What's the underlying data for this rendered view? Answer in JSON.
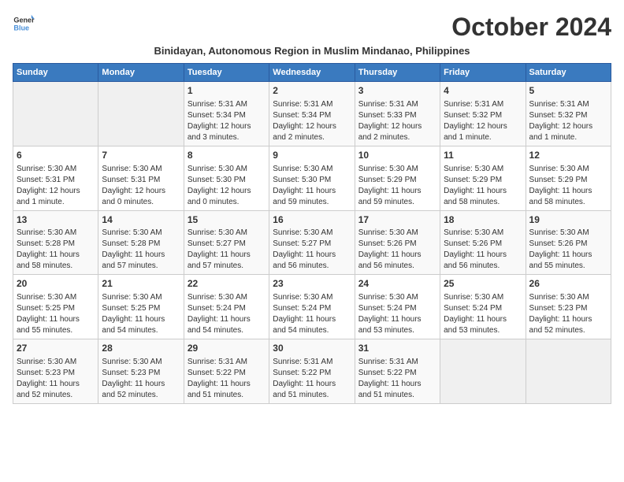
{
  "logo": {
    "line1": "General",
    "line2": "Blue"
  },
  "title": "October 2024",
  "subtitle": "Binidayan, Autonomous Region in Muslim Mindanao, Philippines",
  "days_of_week": [
    "Sunday",
    "Monday",
    "Tuesday",
    "Wednesday",
    "Thursday",
    "Friday",
    "Saturday"
  ],
  "weeks": [
    [
      {
        "day": "",
        "content": ""
      },
      {
        "day": "",
        "content": ""
      },
      {
        "day": "1",
        "content": "Sunrise: 5:31 AM\nSunset: 5:34 PM\nDaylight: 12 hours\nand 3 minutes."
      },
      {
        "day": "2",
        "content": "Sunrise: 5:31 AM\nSunset: 5:34 PM\nDaylight: 12 hours\nand 2 minutes."
      },
      {
        "day": "3",
        "content": "Sunrise: 5:31 AM\nSunset: 5:33 PM\nDaylight: 12 hours\nand 2 minutes."
      },
      {
        "day": "4",
        "content": "Sunrise: 5:31 AM\nSunset: 5:32 PM\nDaylight: 12 hours\nand 1 minute."
      },
      {
        "day": "5",
        "content": "Sunrise: 5:31 AM\nSunset: 5:32 PM\nDaylight: 12 hours\nand 1 minute."
      }
    ],
    [
      {
        "day": "6",
        "content": "Sunrise: 5:30 AM\nSunset: 5:31 PM\nDaylight: 12 hours\nand 1 minute."
      },
      {
        "day": "7",
        "content": "Sunrise: 5:30 AM\nSunset: 5:31 PM\nDaylight: 12 hours\nand 0 minutes."
      },
      {
        "day": "8",
        "content": "Sunrise: 5:30 AM\nSunset: 5:30 PM\nDaylight: 12 hours\nand 0 minutes."
      },
      {
        "day": "9",
        "content": "Sunrise: 5:30 AM\nSunset: 5:30 PM\nDaylight: 11 hours\nand 59 minutes."
      },
      {
        "day": "10",
        "content": "Sunrise: 5:30 AM\nSunset: 5:29 PM\nDaylight: 11 hours\nand 59 minutes."
      },
      {
        "day": "11",
        "content": "Sunrise: 5:30 AM\nSunset: 5:29 PM\nDaylight: 11 hours\nand 58 minutes."
      },
      {
        "day": "12",
        "content": "Sunrise: 5:30 AM\nSunset: 5:29 PM\nDaylight: 11 hours\nand 58 minutes."
      }
    ],
    [
      {
        "day": "13",
        "content": "Sunrise: 5:30 AM\nSunset: 5:28 PM\nDaylight: 11 hours\nand 58 minutes."
      },
      {
        "day": "14",
        "content": "Sunrise: 5:30 AM\nSunset: 5:28 PM\nDaylight: 11 hours\nand 57 minutes."
      },
      {
        "day": "15",
        "content": "Sunrise: 5:30 AM\nSunset: 5:27 PM\nDaylight: 11 hours\nand 57 minutes."
      },
      {
        "day": "16",
        "content": "Sunrise: 5:30 AM\nSunset: 5:27 PM\nDaylight: 11 hours\nand 56 minutes."
      },
      {
        "day": "17",
        "content": "Sunrise: 5:30 AM\nSunset: 5:26 PM\nDaylight: 11 hours\nand 56 minutes."
      },
      {
        "day": "18",
        "content": "Sunrise: 5:30 AM\nSunset: 5:26 PM\nDaylight: 11 hours\nand 56 minutes."
      },
      {
        "day": "19",
        "content": "Sunrise: 5:30 AM\nSunset: 5:26 PM\nDaylight: 11 hours\nand 55 minutes."
      }
    ],
    [
      {
        "day": "20",
        "content": "Sunrise: 5:30 AM\nSunset: 5:25 PM\nDaylight: 11 hours\nand 55 minutes."
      },
      {
        "day": "21",
        "content": "Sunrise: 5:30 AM\nSunset: 5:25 PM\nDaylight: 11 hours\nand 54 minutes."
      },
      {
        "day": "22",
        "content": "Sunrise: 5:30 AM\nSunset: 5:24 PM\nDaylight: 11 hours\nand 54 minutes."
      },
      {
        "day": "23",
        "content": "Sunrise: 5:30 AM\nSunset: 5:24 PM\nDaylight: 11 hours\nand 54 minutes."
      },
      {
        "day": "24",
        "content": "Sunrise: 5:30 AM\nSunset: 5:24 PM\nDaylight: 11 hours\nand 53 minutes."
      },
      {
        "day": "25",
        "content": "Sunrise: 5:30 AM\nSunset: 5:24 PM\nDaylight: 11 hours\nand 53 minutes."
      },
      {
        "day": "26",
        "content": "Sunrise: 5:30 AM\nSunset: 5:23 PM\nDaylight: 11 hours\nand 52 minutes."
      }
    ],
    [
      {
        "day": "27",
        "content": "Sunrise: 5:30 AM\nSunset: 5:23 PM\nDaylight: 11 hours\nand 52 minutes."
      },
      {
        "day": "28",
        "content": "Sunrise: 5:30 AM\nSunset: 5:23 PM\nDaylight: 11 hours\nand 52 minutes."
      },
      {
        "day": "29",
        "content": "Sunrise: 5:31 AM\nSunset: 5:22 PM\nDaylight: 11 hours\nand 51 minutes."
      },
      {
        "day": "30",
        "content": "Sunrise: 5:31 AM\nSunset: 5:22 PM\nDaylight: 11 hours\nand 51 minutes."
      },
      {
        "day": "31",
        "content": "Sunrise: 5:31 AM\nSunset: 5:22 PM\nDaylight: 11 hours\nand 51 minutes."
      },
      {
        "day": "",
        "content": ""
      },
      {
        "day": "",
        "content": ""
      }
    ]
  ]
}
